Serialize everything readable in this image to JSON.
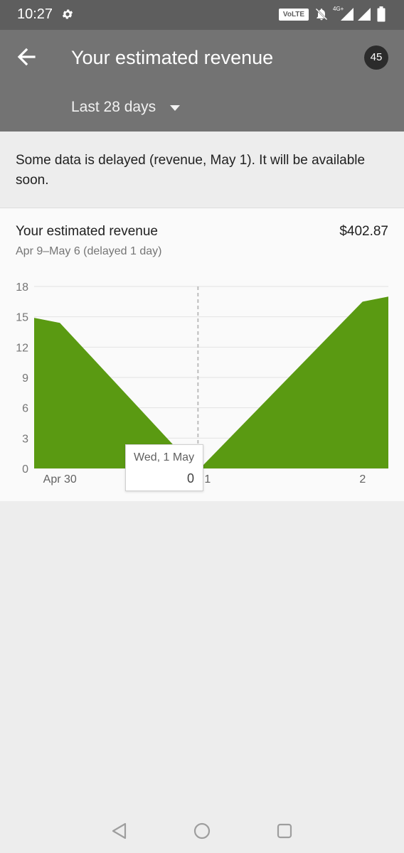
{
  "status_bar": {
    "time": "10:27",
    "volte": "VoLTE",
    "network": "4G+",
    "icons": [
      "gear-icon",
      "mute-bell-icon",
      "signal-icon",
      "signal-icon",
      "battery-icon"
    ]
  },
  "app_bar": {
    "title": "Your estimated revenue",
    "badge_count": "45",
    "period_label": "Last 28 days",
    "background": "#737373"
  },
  "notice": {
    "text": "Some data is delayed (revenue, May 1). It will be available soon."
  },
  "card": {
    "title": "Your estimated revenue",
    "total": "$402.87",
    "subtitle": "Apr 9–May 6 (delayed 1 day)"
  },
  "tooltip": {
    "title": "Wed, 1 May",
    "value": "0"
  },
  "nav_bar": {
    "icons": [
      "back-triangle-icon",
      "home-circle-icon",
      "recents-square-icon"
    ]
  },
  "chart_data": {
    "type": "area",
    "color": "#5a9a12",
    "x_labels": [
      "Apr 30",
      "ay 1",
      "2"
    ],
    "y_ticks": [
      0,
      3,
      6,
      9,
      12,
      15,
      18
    ],
    "ylim": [
      0,
      18
    ],
    "grid": true,
    "series": [
      {
        "points": [
          {
            "x": 0,
            "y": 14.9
          },
          {
            "x": 0.8,
            "y": 14.4
          },
          {
            "x": 5.0,
            "y": 0
          },
          {
            "x": 5.15,
            "y": 0
          },
          {
            "x": 10.2,
            "y": 16.5
          },
          {
            "x": 11.0,
            "y": 17.0
          }
        ]
      }
    ],
    "x_positions": [
      0.8,
      5.15,
      10.2
    ],
    "xlim": [
      0,
      11.0
    ],
    "highlight_x": 5.0
  }
}
